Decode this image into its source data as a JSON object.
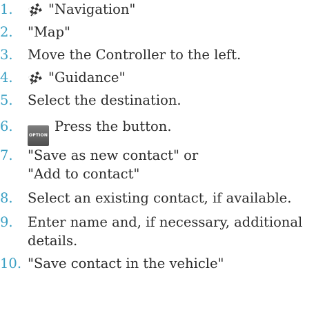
{
  "steps": [
    {
      "number": "1.",
      "text": "\"Navigation\"",
      "icon": "checkered-flag-icon"
    },
    {
      "number": "2.",
      "text": "\"Map\""
    },
    {
      "number": "3.",
      "text": "Move the Controller to the left."
    },
    {
      "number": "4.",
      "text": "\"Guidance\"",
      "icon": "checkered-flag-icon"
    },
    {
      "number": "5.",
      "text": "Select the destination."
    },
    {
      "number": "6.",
      "text": "Press the button.",
      "button_label": "OPTION",
      "icon": "option-button-icon"
    },
    {
      "number": "7.",
      "text": "\"Save as new contact\" or \"Add to contact\""
    },
    {
      "number": "8.",
      "text": "Select an existing contact, if available."
    },
    {
      "number": "9.",
      "text": "Enter name and, if necessary, additional details."
    },
    {
      "number": "10.",
      "text": "\"Save contact in the vehicle\""
    }
  ],
  "colors": {
    "step_number": "#3a9fc3",
    "text": "#2b2b2b"
  }
}
